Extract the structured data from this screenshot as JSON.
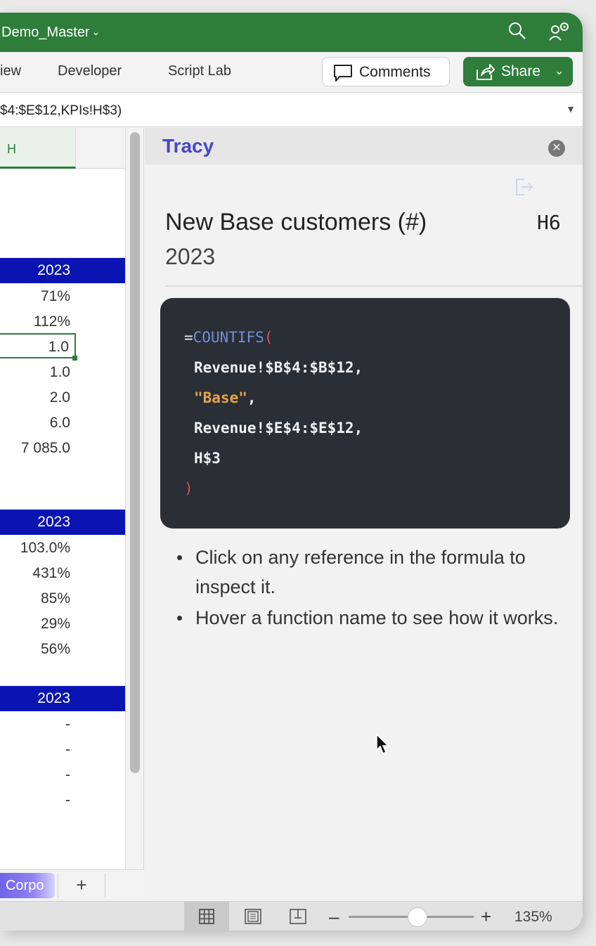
{
  "titlebar": {
    "doc_title": "Demo_Master"
  },
  "ribbon": {
    "tabs": [
      "iew",
      "Developer",
      "Script Lab"
    ],
    "comments_label": "Comments",
    "share_label": "Share"
  },
  "formula_bar": {
    "text": "$4:$E$12,KPIs!H$3)"
  },
  "grid": {
    "column_header": "H",
    "section1": {
      "header": "2023",
      "rows": [
        "71%",
        "112%",
        "1.0",
        "1.0",
        "2.0",
        "6.0",
        "7 085.0"
      ]
    },
    "section2": {
      "header": "2023",
      "rows": [
        "103.0%",
        "431%",
        "85%",
        "29%",
        "56%"
      ]
    },
    "section3": {
      "header": "2023",
      "rows": [
        "-",
        "-",
        "-",
        "-"
      ]
    }
  },
  "sheet_tabs": {
    "active": "Corpo",
    "add_label": "+"
  },
  "pane": {
    "title": "Tracy",
    "cell_name": "New Base customers (#)",
    "cell_ref": "H6",
    "cell_year": "2023",
    "formula": {
      "eq": "=",
      "fn": "COUNTIFS",
      "open": "(",
      "arg1": "Revenue!$B$4:$B$12,",
      "arg2_str": "\"Base\"",
      "arg2_comma": ",",
      "arg3": "Revenue!$E$4:$E$12,",
      "arg4": "H$3",
      "close": ")"
    },
    "tips": [
      "Click on any reference in the formula to inspect it.",
      "Hover a function name to see how it works."
    ]
  },
  "status": {
    "zoom_level": "135%"
  },
  "colors": {
    "excel_green": "#2f7d3b",
    "header_blue": "#0a14b3",
    "pane_title": "#4646c8",
    "code_bg": "#2a2e35"
  }
}
